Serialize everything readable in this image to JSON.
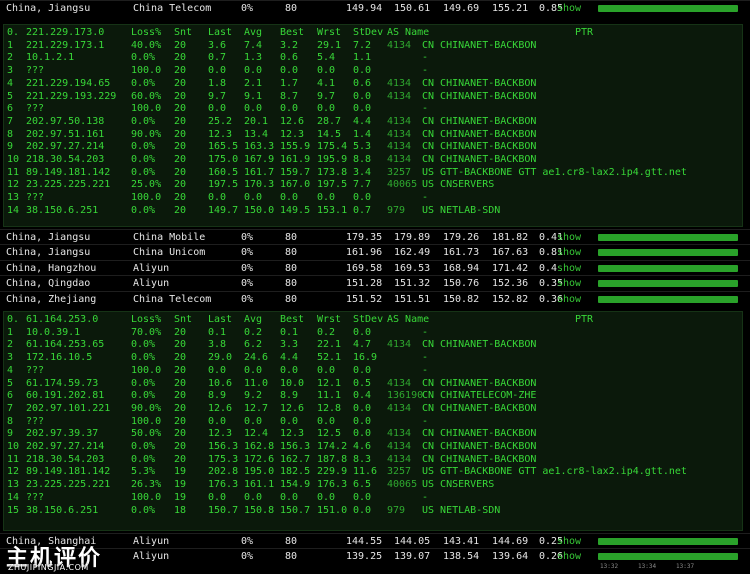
{
  "columns": {
    "loss": "Loss%",
    "snt": "Snt",
    "last": "Last",
    "avg": "Avg",
    "best": "Best",
    "wrst": "Wrst",
    "stdev": "StDev",
    "as": "AS Name",
    "ptr": "PTR"
  },
  "show_label": "show",
  "summary_rows": [
    {
      "location": "China, Jiangsu",
      "isp": "China Telecom",
      "loss": "0%",
      "sent": "80",
      "last": "149.94",
      "avg": "150.61",
      "best": "149.69",
      "worst": "155.21",
      "stdev": "0.85",
      "bar": 0.3
    },
    {
      "location": "China, Jiangsu",
      "isp": "China Mobile",
      "loss": "0%",
      "sent": "80",
      "last": "179.35",
      "avg": "179.89",
      "best": "179.26",
      "worst": "181.82",
      "stdev": "0.41",
      "bar": 0.3
    },
    {
      "location": "China, Jiangsu",
      "isp": "China Unicom",
      "loss": "0%",
      "sent": "80",
      "last": "161.96",
      "avg": "162.49",
      "best": "161.73",
      "worst": "167.63",
      "stdev": "0.81",
      "bar": 0.3
    },
    {
      "location": "China, Hangzhou",
      "isp": "Aliyun",
      "loss": "0%",
      "sent": "80",
      "last": "169.58",
      "avg": "169.53",
      "best": "168.94",
      "worst": "171.42",
      "stdev": "0.4",
      "bar": 0.3
    },
    {
      "location": "China, Qingdao",
      "isp": "Aliyun",
      "loss": "0%",
      "sent": "80",
      "last": "151.28",
      "avg": "151.32",
      "best": "150.76",
      "worst": "152.36",
      "stdev": "0.35",
      "bar": 0.3
    },
    {
      "location": "China, Zhejiang",
      "isp": "China Telecom",
      "loss": "0%",
      "sent": "80",
      "last": "151.52",
      "avg": "151.51",
      "best": "150.82",
      "worst": "152.82",
      "stdev": "0.36",
      "bar": 0.3
    },
    {
      "location": "China, Jiangsu",
      "isp": "China Unicom",
      "loss": "0%",
      "sent": "80",
      "last": "161.96",
      "avg": "162.49",
      "best": "161.73",
      "worst": "167.63",
      "stdev": "0.81",
      "bar": 0.3
    },
    {
      "location": "China, Shanghai",
      "isp": "Aliyun",
      "loss": "0%",
      "sent": "80",
      "last": "144.55",
      "avg": "144.05",
      "best": "143.41",
      "worst": "144.69",
      "stdev": "0.25",
      "bar": 0.3
    },
    {
      "location": "",
      "isp": "Aliyun",
      "loss": "0%",
      "sent": "80",
      "last": "139.25",
      "avg": "139.07",
      "best": "138.54",
      "worst": "139.64",
      "stdev": "0.26",
      "bar": 0.3
    }
  ],
  "mtr1": [
    {
      "hop": "0.",
      "host": "221.229.173.0",
      "loss": "",
      "snt": "",
      "last": "",
      "avg": "",
      "best": "",
      "wrst": "",
      "stdev": "",
      "asn": "",
      "as": ""
    },
    {
      "hop": "1",
      "host": "221.229.173.1",
      "loss": "40.0%",
      "snt": "20",
      "last": "3.6",
      "avg": "7.4",
      "best": "3.2",
      "wrst": "29.1",
      "stdev": "7.2",
      "asn": "4134",
      "as": "CN CHINANET-BACKBON"
    },
    {
      "hop": "2",
      "host": "10.1.2.1",
      "loss": "0.0%",
      "snt": "20",
      "last": "0.7",
      "avg": "1.3",
      "best": "0.6",
      "wrst": "5.4",
      "stdev": "1.1",
      "asn": "",
      "as": "-"
    },
    {
      "hop": "3",
      "host": "???",
      "loss": "100.0",
      "snt": "20",
      "last": "0.0",
      "avg": "0.0",
      "best": "0.0",
      "wrst": "0.0",
      "stdev": "0.0",
      "asn": "",
      "as": "-"
    },
    {
      "hop": "4",
      "host": "221.229.194.65",
      "loss": "0.0%",
      "snt": "20",
      "last": "1.8",
      "avg": "2.1",
      "best": "1.7",
      "wrst": "4.1",
      "stdev": "0.6",
      "asn": "4134",
      "as": "CN CHINANET-BACKBON"
    },
    {
      "hop": "5",
      "host": "221.229.193.229",
      "loss": "60.0%",
      "snt": "20",
      "last": "9.7",
      "avg": "9.1",
      "best": "8.7",
      "wrst": "9.7",
      "stdev": "0.0",
      "asn": "4134",
      "as": "CN CHINANET-BACKBON"
    },
    {
      "hop": "6",
      "host": "???",
      "loss": "100.0",
      "snt": "20",
      "last": "0.0",
      "avg": "0.0",
      "best": "0.0",
      "wrst": "0.0",
      "stdev": "0.0",
      "asn": "",
      "as": "-"
    },
    {
      "hop": "7",
      "host": "202.97.50.138",
      "loss": "0.0%",
      "snt": "20",
      "last": "25.2",
      "avg": "20.1",
      "best": "12.6",
      "wrst": "28.7",
      "stdev": "4.4",
      "asn": "4134",
      "as": "CN CHINANET-BACKBON"
    },
    {
      "hop": "8",
      "host": "202.97.51.161",
      "loss": "90.0%",
      "snt": "20",
      "last": "12.3",
      "avg": "13.4",
      "best": "12.3",
      "wrst": "14.5",
      "stdev": "1.4",
      "asn": "4134",
      "as": "CN CHINANET-BACKBON"
    },
    {
      "hop": "9",
      "host": "202.97.27.214",
      "loss": "0.0%",
      "snt": "20",
      "last": "165.5",
      "avg": "163.3",
      "best": "155.9",
      "wrst": "175.4",
      "stdev": "5.3",
      "asn": "4134",
      "as": "CN CHINANET-BACKBON"
    },
    {
      "hop": "10",
      "host": "218.30.54.203",
      "loss": "0.0%",
      "snt": "20",
      "last": "175.0",
      "avg": "167.9",
      "best": "161.9",
      "wrst": "195.9",
      "stdev": "8.8",
      "asn": "4134",
      "as": "CN CHINANET-BACKBON"
    },
    {
      "hop": "11",
      "host": "89.149.181.142",
      "loss": "0.0%",
      "snt": "20",
      "last": "160.5",
      "avg": "161.7",
      "best": "159.7",
      "wrst": "173.8",
      "stdev": "3.4",
      "asn": "3257",
      "as": "US GTT-BACKBONE GTT ae1.cr8-lax2.ip4.gtt.net"
    },
    {
      "hop": "12",
      "host": "23.225.225.221",
      "loss": "25.0%",
      "snt": "20",
      "last": "197.5",
      "avg": "170.3",
      "best": "167.0",
      "wrst": "197.5",
      "stdev": "7.7",
      "asn": "40065",
      "as": "US CNSERVERS"
    },
    {
      "hop": "13",
      "host": "???",
      "loss": "100.0",
      "snt": "20",
      "last": "0.0",
      "avg": "0.0",
      "best": "0.0",
      "wrst": "0.0",
      "stdev": "0.0",
      "asn": "",
      "as": "-"
    },
    {
      "hop": "14",
      "host": "38.150.6.251",
      "loss": "0.0%",
      "snt": "20",
      "last": "149.7",
      "avg": "150.0",
      "best": "149.5",
      "wrst": "153.1",
      "stdev": "0.7",
      "asn": "979",
      "as": "US NETLAB-SDN"
    }
  ],
  "mtr2": [
    {
      "hop": "0.",
      "host": "61.164.253.0",
      "loss": "",
      "snt": "",
      "last": "",
      "avg": "",
      "best": "",
      "wrst": "",
      "stdev": "",
      "asn": "",
      "as": ""
    },
    {
      "hop": "1",
      "host": "10.0.39.1",
      "loss": "70.0%",
      "snt": "20",
      "last": "0.1",
      "avg": "0.2",
      "best": "0.1",
      "wrst": "0.2",
      "stdev": "0.0",
      "asn": "",
      "as": "-"
    },
    {
      "hop": "2",
      "host": "61.164.253.65",
      "loss": "0.0%",
      "snt": "20",
      "last": "3.8",
      "avg": "6.2",
      "best": "3.3",
      "wrst": "22.1",
      "stdev": "4.7",
      "asn": "4134",
      "as": "CN CHINANET-BACKBON"
    },
    {
      "hop": "3",
      "host": "172.16.10.5",
      "loss": "0.0%",
      "snt": "20",
      "last": "29.0",
      "avg": "24.6",
      "best": "4.4",
      "wrst": "52.1",
      "stdev": "16.9",
      "asn": "",
      "as": "-"
    },
    {
      "hop": "4",
      "host": "???",
      "loss": "100.0",
      "snt": "20",
      "last": "0.0",
      "avg": "0.0",
      "best": "0.0",
      "wrst": "0.0",
      "stdev": "0.0",
      "asn": "",
      "as": "-"
    },
    {
      "hop": "5",
      "host": "61.174.59.73",
      "loss": "0.0%",
      "snt": "20",
      "last": "10.6",
      "avg": "11.0",
      "best": "10.0",
      "wrst": "12.1",
      "stdev": "0.5",
      "asn": "4134",
      "as": "CN CHINANET-BACKBON"
    },
    {
      "hop": "6",
      "host": "60.191.202.81",
      "loss": "0.0%",
      "snt": "20",
      "last": "8.9",
      "avg": "9.2",
      "best": "8.9",
      "wrst": "11.1",
      "stdev": "0.4",
      "asn": "136190",
      "as": "CN CHINATELECOM-ZHE"
    },
    {
      "hop": "7",
      "host": "202.97.101.221",
      "loss": "90.0%",
      "snt": "20",
      "last": "12.6",
      "avg": "12.7",
      "best": "12.6",
      "wrst": "12.8",
      "stdev": "0.0",
      "asn": "4134",
      "as": "CN CHINANET-BACKBON"
    },
    {
      "hop": "8",
      "host": "???",
      "loss": "100.0",
      "snt": "20",
      "last": "0.0",
      "avg": "0.0",
      "best": "0.0",
      "wrst": "0.0",
      "stdev": "0.0",
      "asn": "",
      "as": "-"
    },
    {
      "hop": "9",
      "host": "202.97.39.37",
      "loss": "50.0%",
      "snt": "20",
      "last": "12.3",
      "avg": "12.4",
      "best": "12.3",
      "wrst": "12.5",
      "stdev": "0.0",
      "asn": "4134",
      "as": "CN CHINANET-BACKBON"
    },
    {
      "hop": "10",
      "host": "202.97.27.214",
      "loss": "0.0%",
      "snt": "20",
      "last": "156.3",
      "avg": "162.8",
      "best": "156.3",
      "wrst": "174.2",
      "stdev": "4.6",
      "asn": "4134",
      "as": "CN CHINANET-BACKBON"
    },
    {
      "hop": "11",
      "host": "218.30.54.203",
      "loss": "0.0%",
      "snt": "20",
      "last": "175.3",
      "avg": "172.6",
      "best": "162.7",
      "wrst": "187.8",
      "stdev": "8.3",
      "asn": "4134",
      "as": "CN CHINANET-BACKBON"
    },
    {
      "hop": "12",
      "host": "89.149.181.142",
      "loss": "5.3%",
      "snt": "19",
      "last": "202.8",
      "avg": "195.0",
      "best": "182.5",
      "wrst": "229.9",
      "stdev": "11.6",
      "asn": "3257",
      "as": "US GTT-BACKBONE GTT ae1.cr8-lax2.ip4.gtt.net"
    },
    {
      "hop": "13",
      "host": "23.225.225.221",
      "loss": "26.3%",
      "snt": "19",
      "last": "176.3",
      "avg": "161.1",
      "best": "154.9",
      "wrst": "176.3",
      "stdev": "6.5",
      "asn": "40065",
      "as": "US CNSERVERS"
    },
    {
      "hop": "14",
      "host": "???",
      "loss": "100.0",
      "snt": "19",
      "last": "0.0",
      "avg": "0.0",
      "best": "0.0",
      "wrst": "0.0",
      "stdev": "0.0",
      "asn": "",
      "as": "-"
    },
    {
      "hop": "15",
      "host": "38.150.6.251",
      "loss": "0.0%",
      "snt": "18",
      "last": "150.7",
      "avg": "150.8",
      "best": "150.7",
      "wrst": "151.0",
      "stdev": "0.0",
      "asn": "979",
      "as": "US NETLAB-SDN"
    }
  ],
  "watermark": {
    "main": "主机评价",
    "sub": "ZHUJIPINGJIA.COM"
  },
  "chart_ticks": [
    "13:32",
    "13:34",
    "13:37"
  ],
  "colors": {
    "accent": "#38d838",
    "bar": "#2aa22a",
    "background": "#000000",
    "panel": "#0b190b"
  }
}
